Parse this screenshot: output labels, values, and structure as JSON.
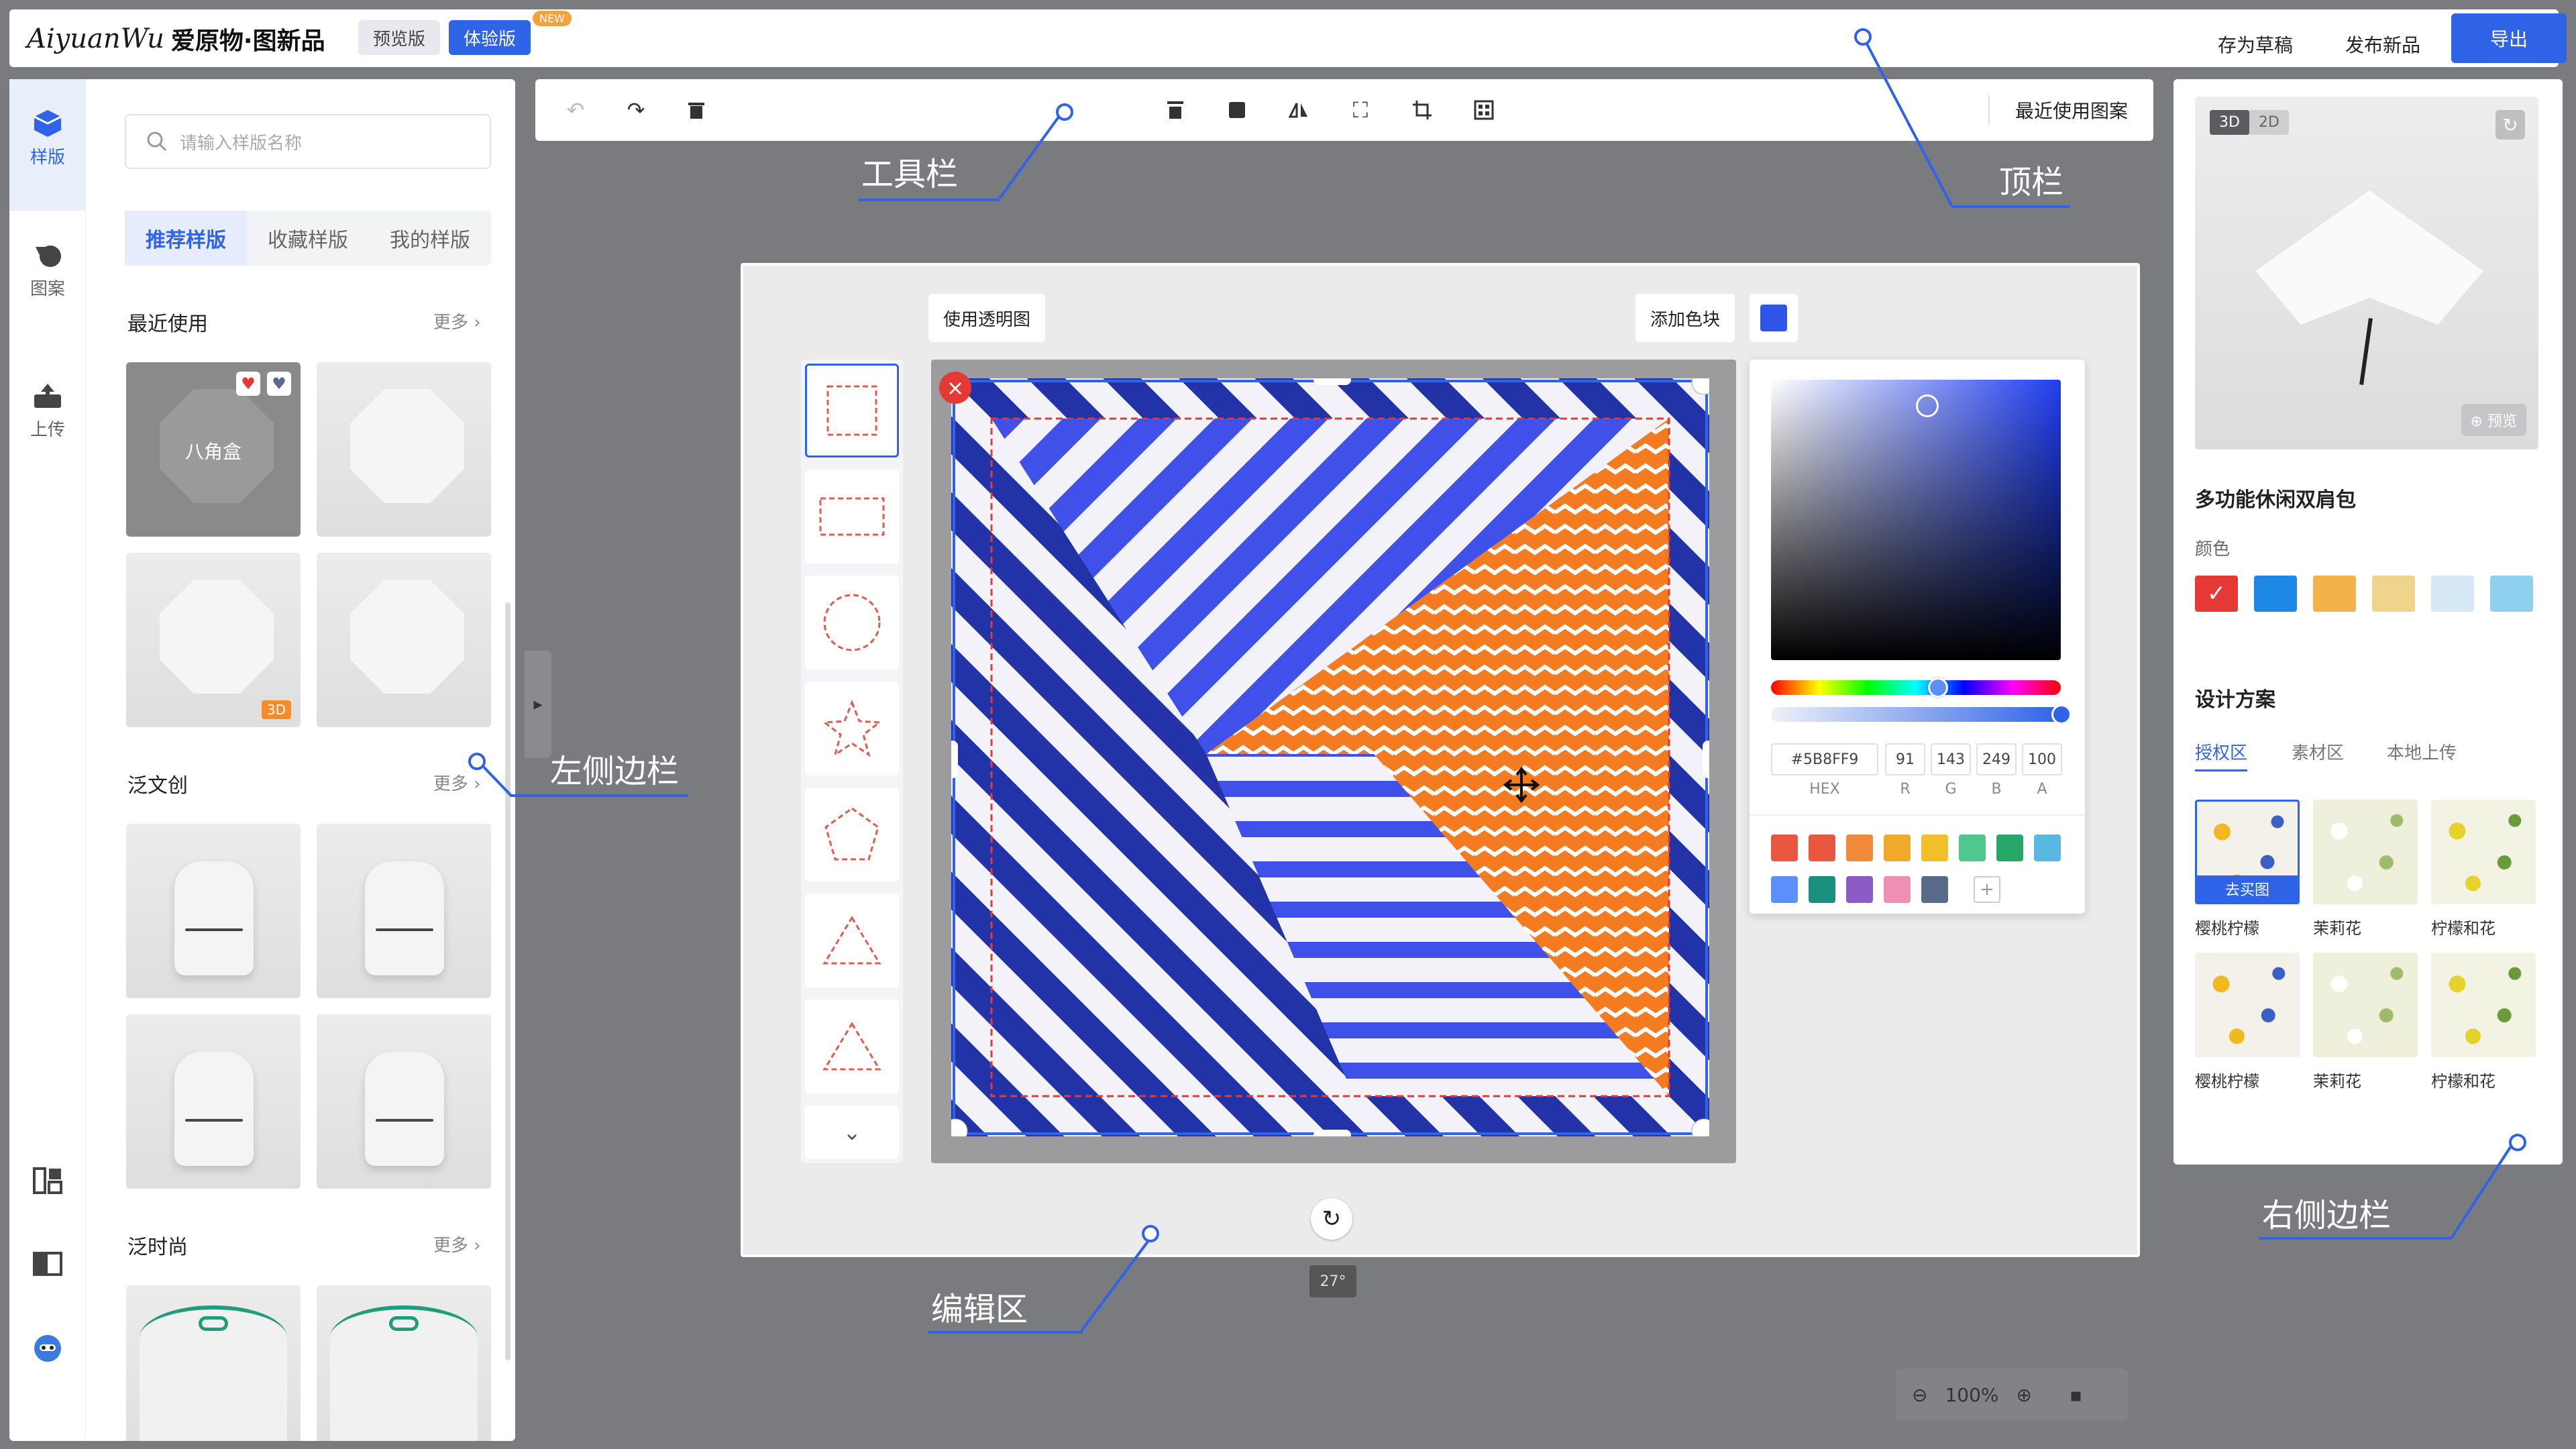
{
  "topbar": {
    "logo_script": "AiyuanWu",
    "logo_cn": "爱原物·图新品",
    "preview_label": "预览版",
    "trial_label": "体验版",
    "new_badge": "NEW",
    "save_draft": "存为草稿",
    "publish": "发布新品",
    "export": "导出"
  },
  "rail": {
    "items": [
      {
        "label": "样版",
        "icon": "cube-icon"
      },
      {
        "label": "图案",
        "icon": "shapes-icon"
      },
      {
        "label": "上传",
        "icon": "upload-icon"
      }
    ]
  },
  "left_panel": {
    "search_placeholder": "请输入样版名称",
    "tabs": [
      "推荐样版",
      "收藏样版",
      "我的样版"
    ],
    "sections": [
      {
        "title": "最近使用",
        "more": "更多"
      },
      {
        "title": "泛文创",
        "more": "更多"
      },
      {
        "title": "泛时尚",
        "more": "更多"
      }
    ],
    "recent_first_label": "八角盒",
    "tag_3d": "3D"
  },
  "toolbar": {
    "recent_pattern": "最近使用图案"
  },
  "editor": {
    "use_transparent": "使用透明图",
    "add_color_block": "添加色块",
    "angle": "27°"
  },
  "picker": {
    "hex": "#5B8FF9",
    "r": "91",
    "g": "143",
    "b": "249",
    "a": "100",
    "labels": [
      "HEX",
      "R",
      "G",
      "B",
      "A"
    ],
    "swatches": [
      "#e8573f",
      "#e8573f",
      "#f08a3a",
      "#f0a92a",
      "#f0bf2a",
      "#4fc78f",
      "#27a768",
      "#5ab7e0",
      "#5b8ff9",
      "#1d8f7e",
      "#8b5bc6",
      "#f08fb4",
      "#5a6a8a"
    ],
    "add_glyph": "+"
  },
  "zoom": {
    "level": "100%"
  },
  "right_panel": {
    "dim_3d": "3D",
    "dim_2d": "2D",
    "preview": "预览",
    "product_title": "多功能休闲双肩包",
    "color_label": "颜色",
    "colors": [
      "#e53935",
      "#1e88e5",
      "#f2b34a",
      "#f1d48b",
      "#d6e8f5",
      "#8fd0ee"
    ],
    "design_title": "设计方案",
    "design_tabs": [
      "授权区",
      "素材区",
      "本地上传"
    ],
    "patterns": [
      {
        "label": "樱桃柠檬",
        "bg": "#f4f1ea",
        "dot": "#f2b820",
        "dot2": "#3a60c6"
      },
      {
        "label": "茉莉花",
        "bg": "#eef0dc",
        "dot": "#ffffff",
        "dot2": "#9dbb6a"
      },
      {
        "label": "柠檬和花",
        "bg": "#f3f3e4",
        "dot": "#e5d22a",
        "dot2": "#6a9a3a"
      },
      {
        "label": "樱桃柠檬",
        "bg": "#f4f1ea",
        "dot": "#f2b820",
        "dot2": "#3a60c6"
      },
      {
        "label": "茉莉花",
        "bg": "#eef0dc",
        "dot": "#ffffff",
        "dot2": "#9dbb6a"
      },
      {
        "label": "柠檬和花",
        "bg": "#f3f3e4",
        "dot": "#e5d22a",
        "dot2": "#6a9a3a"
      }
    ],
    "buy_label": "去买图"
  },
  "annotations": {
    "toolbar": "工具栏",
    "topbar": "顶栏",
    "left_sidebar": "左侧边栏",
    "edit_area": "编辑区",
    "right_sidebar": "右侧边栏"
  },
  "accent": "#2f63e8"
}
